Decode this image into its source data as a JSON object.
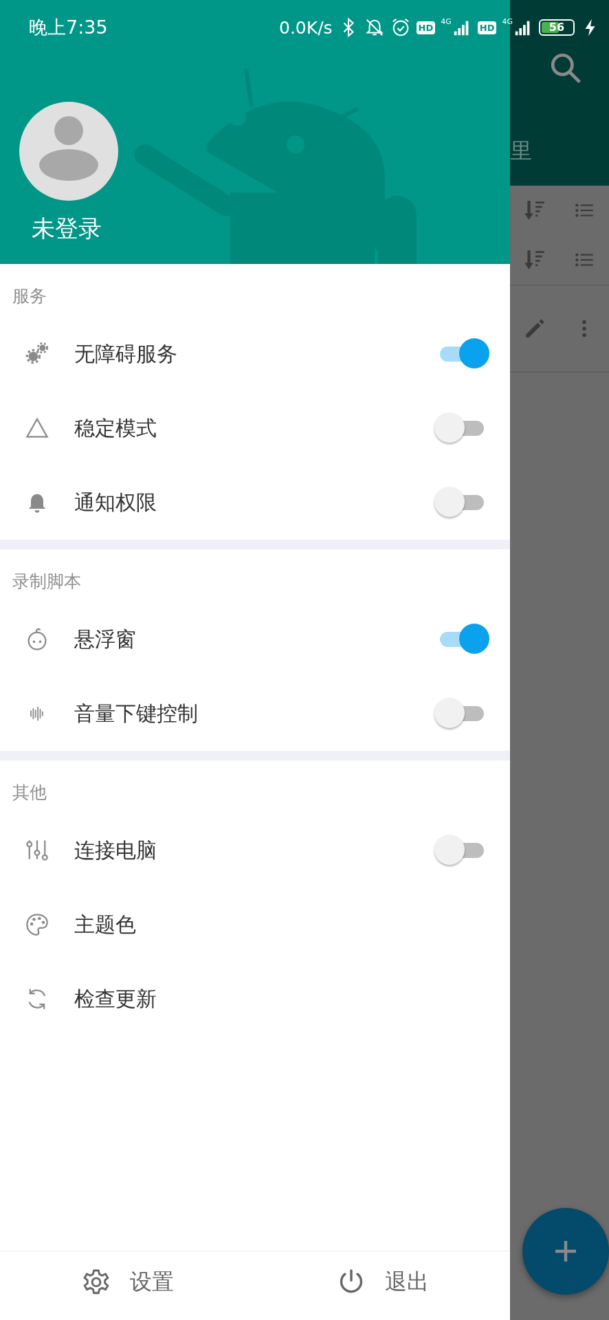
{
  "status_bar": {
    "time": "晚上7:35",
    "net_speed": "0.0K/s",
    "badges": [
      "HD",
      "HD"
    ],
    "networks": [
      "4G",
      "4G"
    ],
    "battery": "56"
  },
  "header": {
    "user_name": "未登录"
  },
  "background_app": {
    "title_fragment": "里"
  },
  "sections": [
    {
      "title": "服务",
      "items": [
        {
          "label": "无障碍服务",
          "kind": "switch",
          "on": true
        },
        {
          "label": "稳定模式",
          "kind": "switch",
          "on": false
        },
        {
          "label": "通知权限",
          "kind": "switch",
          "on": false
        }
      ]
    },
    {
      "title": "录制脚本",
      "items": [
        {
          "label": "悬浮窗",
          "kind": "switch",
          "on": true
        },
        {
          "label": "音量下键控制",
          "kind": "switch",
          "on": false
        }
      ]
    },
    {
      "title": "其他",
      "items": [
        {
          "label": "连接电脑",
          "kind": "switch",
          "on": false
        },
        {
          "label": "主题色",
          "kind": "link"
        },
        {
          "label": "检查更新",
          "kind": "link"
        }
      ]
    }
  ],
  "footer": [
    {
      "label": "设置"
    },
    {
      "label": "退出"
    }
  ]
}
